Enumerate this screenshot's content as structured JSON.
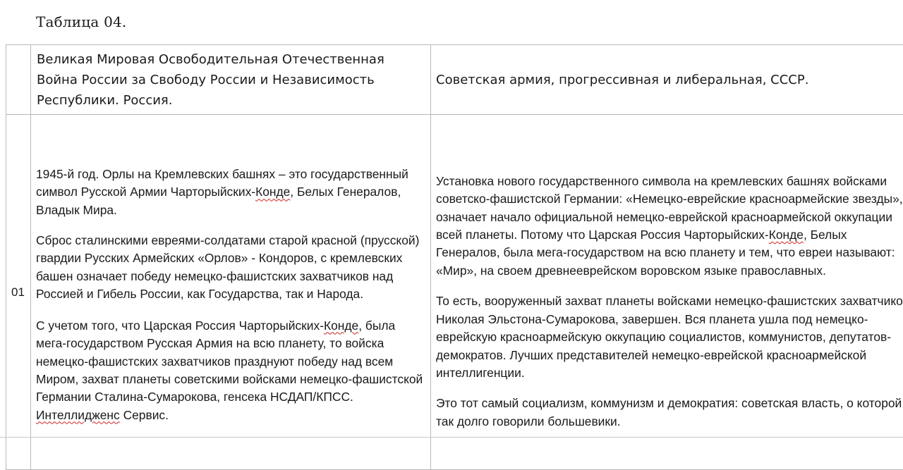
{
  "caption": "Таблица 04.",
  "table": {
    "header": {
      "left": "Великая  Мировая Освободительная Отечественная Война России за Свободу России и Независимость Республики. Россия.",
      "right": "Советская армия, прогрессивная и либеральная, СССР."
    },
    "row": {
      "number": "01",
      "left_paragraphs": [
        [
          {
            "text": " 1945-й год. Орлы на Кремлевских башнях – это государственный символ Русской Армии Чарторыйских-"
          },
          {
            "text": "Конде",
            "spell": true
          },
          {
            "text": ", Белых Генералов, Владык Мира."
          }
        ],
        [
          {
            "text": "Сброс сталинскими евреями-солдатами старой красной (прусской) гвардии Русских Армейских «Орлов» - Кондоров,  с кремлевских башен означает победу немецко-фашистских захватчиков над Россией и Гибель России, как Государства, так и Народа."
          }
        ],
        [
          {
            "text": "С учетом того, что Царская Россия Чарторыйских-"
          },
          {
            "text": "Конде",
            "spell": true
          },
          {
            "text": ", была мега-государством Русская Армия на всю планету, то войска немецко-фашистских захватчиков празднуют победу над всем Миром,  захват планеты советскими войсками немецко-фашистской Германии Сталина-Сумарокова, генсека НСДАП/КПСС. "
          },
          {
            "text": "Интеллидженс",
            "spell": true
          },
          {
            "text": " Сервис."
          }
        ]
      ],
      "right_paragraphs": [
        [
          {
            "text": "Установка нового государственного символа на кремлевских башнях войсками советско-фашистской Германии: «Немецко-еврейские красноармейские звезды», означает начало официальной немецко-еврейской красноармейской оккупации всей планеты. Потому что Царская Россия Чарторыйских-"
          },
          {
            "text": "Конде",
            "spell": true
          },
          {
            "text": ", Белых Генералов, была мега-государством на всю планету и тем, что евреи называют: «Мир», на своем древнееврейском воровском языке православных."
          }
        ],
        [
          {
            "text": "То есть, вооруженный захват планеты войсками немецко-фашистских захватчиков Николая Эльстона-Сумарокова, завершен. Вся планета ушла под немецко-еврейскую красноармейскую оккупацию социалистов, коммунистов, депутатов-демократов. Лучших представителей немецко-еврейской красноармейской интеллигенции."
          }
        ],
        [
          {
            "text": "Это тот самый социализм, коммунизм и демократия: советская власть, о которой так долго говорили большевики."
          }
        ]
      ]
    }
  }
}
